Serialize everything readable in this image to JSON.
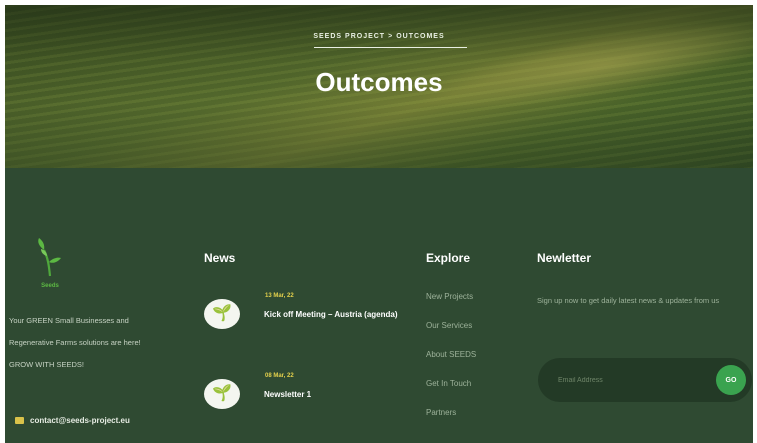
{
  "hero": {
    "breadcrumb": [
      "SEEDS PROJECT",
      "OUTCOMES"
    ],
    "breadcrumb_separator": ">",
    "title": "Outcomes"
  },
  "footer": {
    "logo_text": "Seeds",
    "about_lines": [
      "Your GREEN Small Businesses and",
      "Regenerative Farms solutions are here!",
      "GROW WITH SEEDS!"
    ],
    "contact_email": "contact@seeds-project.eu",
    "news": {
      "title": "News",
      "items": [
        {
          "date": "13 Mar, 22",
          "headline": "Kick off Meeting – Austria (agenda)"
        },
        {
          "date": "08 Mar, 22",
          "headline": "Newsletter 1"
        }
      ]
    },
    "explore": {
      "title": "Explore",
      "links": [
        "New Projects",
        "Our Services",
        "About SEEDS",
        "Get In Touch",
        "Partners"
      ]
    },
    "newsletter": {
      "title": "Newletter",
      "description": "Sign up now to get daily latest news & updates from us",
      "placeholder": "Email Address",
      "button_label": "GO"
    }
  },
  "colors": {
    "footer_bg": "#2f4a32",
    "accent_green": "#3aa34f",
    "date_yellow": "#e3d04c"
  }
}
